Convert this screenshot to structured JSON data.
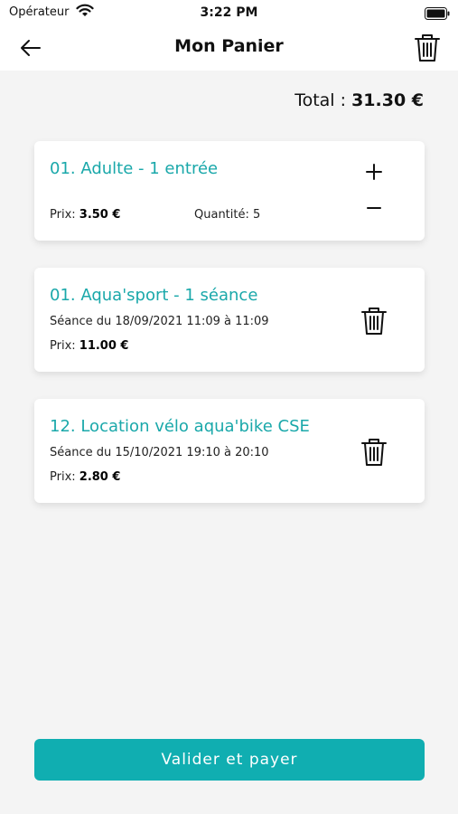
{
  "status_bar": {
    "carrier": "Opérateur",
    "time": "3:22 PM"
  },
  "header": {
    "title": "Mon Panier"
  },
  "total": {
    "label": "Total : ",
    "value": "31.30 €"
  },
  "items": [
    {
      "title": "01.  Adulte - 1 entrée",
      "price_label": "Prix: ",
      "price": "3.50 €",
      "quantity_label": "Quantité: ",
      "quantity": "5"
    },
    {
      "title": "01. Aqua'sport - 1 séance",
      "session": "Séance du 18/09/2021 11:09 à 11:09",
      "price_label": "Prix: ",
      "price": "11.00 €"
    },
    {
      "title": "12. Location vélo aqua'bike CSE",
      "session": "Séance du 15/10/2021 19:10 à 20:10",
      "price_label": "Prix: ",
      "price": "2.80 €"
    }
  ],
  "footer": {
    "pay_label": "Valider et payer"
  },
  "colors": {
    "accent": "#10aeb1",
    "title_teal": "#1aa8aa",
    "background": "#f4f4f4"
  }
}
